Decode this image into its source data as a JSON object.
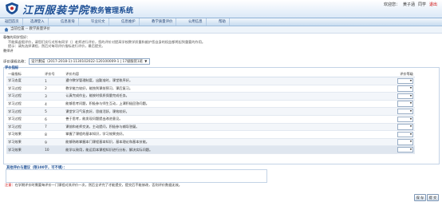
{
  "header": {
    "logo_text": "江西服装学院",
    "system_title": "教务管理系统",
    "welcome": "欢迎您：",
    "user_name": "黄子涵",
    "user_role": "同学",
    "logout": "退出"
  },
  "nav": [
    {
      "label": "返回首页"
    },
    {
      "label": "选课登入"
    },
    {
      "label": "信息查询"
    },
    {
      "label": "毕业论文"
    },
    {
      "label": "信息维护"
    },
    {
      "label": "教学质量评价"
    },
    {
      "label": "公用信息"
    },
    {
      "label": "帮助"
    }
  ],
  "breadcrumb": {
    "text": "当前位置 -- 教学质量评价"
  },
  "notice": {
    "line1": "尊敬的同学您好：",
    "line2": "不能搞虚假评价，请您们实行对所有同学（）老师进行评价，您的评价对提高学校教学质量和维护您自身的权益都将起到重要的作用。",
    "line3": "提示：请先选择课程，然后对每项评价指标进行评价，最后提交。",
    "line4": "教师评"
  },
  "course": {
    "label": "评价课程名称：",
    "selected": "设计素描（2017-2018-1)-1130102022-120100009-1 | 17级服装1班"
  },
  "section_title": "评价指标",
  "table": {
    "headers": [
      "一级指标",
      "评价号",
      "评价内容",
      "评价等级"
    ],
    "rows": [
      {
        "cat": "学习态度",
        "no": "1",
        "content": "遵守教学管理制度，出勤准时，课堂秩序好。",
        "grade": ""
      },
      {
        "cat": "学习过程",
        "no": "2",
        "content": "教学能力较好，能独到课前预习，课后复习。",
        "grade": ""
      },
      {
        "cat": "学习过程",
        "no": "3",
        "content": "认真完成作业，能按时保质保量完成任务。",
        "grade": ""
      },
      {
        "cat": "学习过程",
        "no": "4",
        "content": "能够思考问题，积极参与师生互动，上课积极回答问题。",
        "grade": ""
      },
      {
        "cat": "学习过程",
        "no": "5",
        "content": "课堂学习气氛良好，思维活跃，课效较好。",
        "grade": ""
      },
      {
        "cat": "学习过程",
        "no": "6",
        "content": "善于思考，能发现问题提出改进意见。",
        "grade": ""
      },
      {
        "cat": "学习过程",
        "no": "7",
        "content": "课前和老师交流，主动提问，积极参与辅导答疑。",
        "grade": ""
      },
      {
        "cat": "学习效果",
        "no": "8",
        "content": "掌握了课程的基本知识，学习效果良好。",
        "grade": ""
      },
      {
        "cat": "学习效果",
        "no": "9",
        "content": "能够熟练掌握本门课程基本知识，基本理论和基本技能。",
        "grade": ""
      },
      {
        "cat": "学习效果",
        "no": "10",
        "content": "能学以致用，能运用本课程知识进行分析、解决实际问题。",
        "grade": ""
      }
    ]
  },
  "comment": {
    "label": "其他评价与建议（限100字，可不填）："
  },
  "note": {
    "prefix": "注意：",
    "text": "在学期评价时需要每评价一门课程对其评价一次，然后全评完了才能提交，提交后不能修改，否则评价数据无效。"
  },
  "buttons": {
    "save": "保 存",
    "submit": "提 交"
  },
  "colors": {
    "brand": "#1d4f95",
    "nav_bg": "#c8dcf0",
    "alert": "#cc0000"
  }
}
